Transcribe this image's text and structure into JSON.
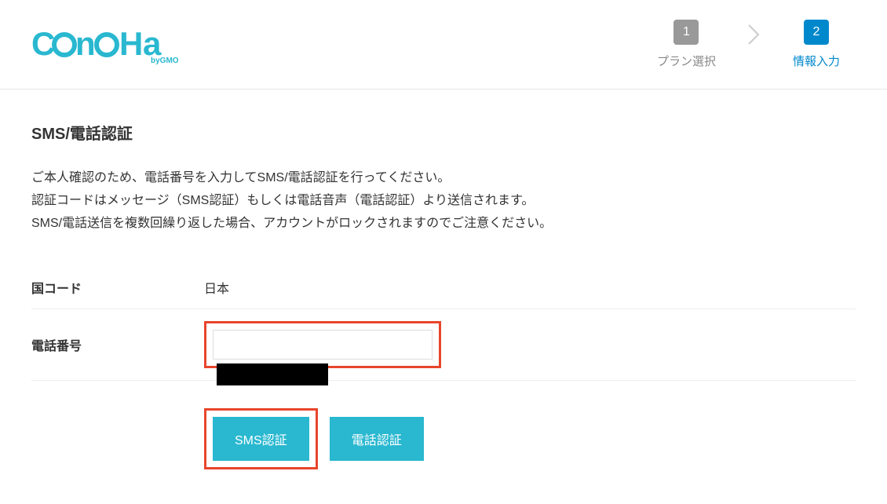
{
  "logo": {
    "brand": "ConoHa",
    "byline": "byGMO"
  },
  "steps": {
    "step1": {
      "number": "1",
      "label": "プラン選択"
    },
    "step2": {
      "number": "2",
      "label": "情報入力"
    }
  },
  "section": {
    "title": "SMS/電話認証",
    "desc_line1": "ご本人確認のため、電話番号を入力してSMS/電話認証を行ってください。",
    "desc_line2": "認証コードはメッセージ（SMS認証）もしくは電話音声（電話認証）より送信されます。",
    "desc_line3": "SMS/電話送信を複数回繰り返した場合、アカウントがロックされますのでご注意ください。"
  },
  "form": {
    "country_label": "国コード",
    "country_value": "日本",
    "phone_label": "電話番号",
    "phone_value": ""
  },
  "buttons": {
    "sms": "SMS認証",
    "tel": "電話認証"
  }
}
